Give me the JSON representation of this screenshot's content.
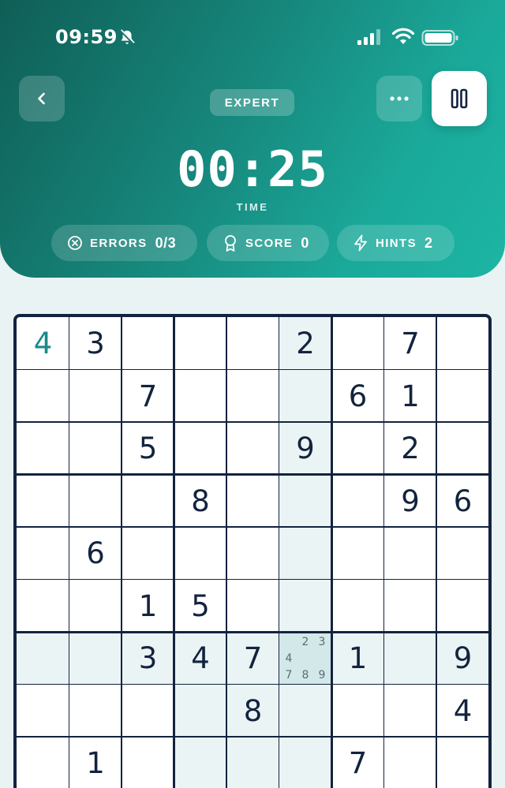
{
  "status_bar": {
    "time": "09:59",
    "icons": [
      "bell-slash-icon",
      "signal-icon",
      "wifi-icon",
      "battery-icon"
    ]
  },
  "header": {
    "difficulty": "EXPERT",
    "timer": "00:25",
    "timer_label": "TIME",
    "buttons": [
      "back-icon",
      "more-icon",
      "pause-icon"
    ]
  },
  "stats": {
    "errors": {
      "label": "ERRORS",
      "value": "0/3",
      "icon": "x-circle-icon"
    },
    "score": {
      "label": "SCORE",
      "value": "0",
      "icon": "award-icon"
    },
    "hints": {
      "label": "HINTS",
      "value": "2",
      "icon": "lightning-icon"
    }
  },
  "colors": {
    "header_gradient_start": "#0f5e56",
    "header_gradient_end": "#1cb5a4",
    "grid_line": "#13233f",
    "user_entry": "#1b8a8a",
    "highlight": "#eaf4f4",
    "selected": "#d3e8e8"
  },
  "board": {
    "selected_cell": {
      "row": 6,
      "col": 5
    },
    "selected_notes": [
      "2",
      "3",
      "4",
      "7",
      "8",
      "9"
    ],
    "rows": [
      [
        "4",
        "3",
        "",
        "",
        "",
        "2",
        "",
        "7",
        ""
      ],
      [
        "",
        "",
        "7",
        "",
        "",
        "",
        "6",
        "1",
        ""
      ],
      [
        "",
        "",
        "5",
        "",
        "",
        "9",
        "",
        "2",
        ""
      ],
      [
        "",
        "",
        "",
        "8",
        "",
        "",
        "",
        "9",
        "6"
      ],
      [
        "",
        "6",
        "",
        "",
        "",
        "",
        "",
        "",
        ""
      ],
      [
        "",
        "",
        "1",
        "5",
        "",
        "",
        "",
        "",
        ""
      ],
      [
        "",
        "",
        "3",
        "4",
        "7",
        "",
        "1",
        "",
        "9"
      ],
      [
        "",
        "",
        "",
        "",
        "8",
        "",
        "",
        "",
        "4"
      ],
      [
        "",
        "1",
        "",
        "",
        "",
        "",
        "7",
        "",
        ""
      ]
    ],
    "user_entries": [
      [
        0,
        0
      ]
    ]
  }
}
